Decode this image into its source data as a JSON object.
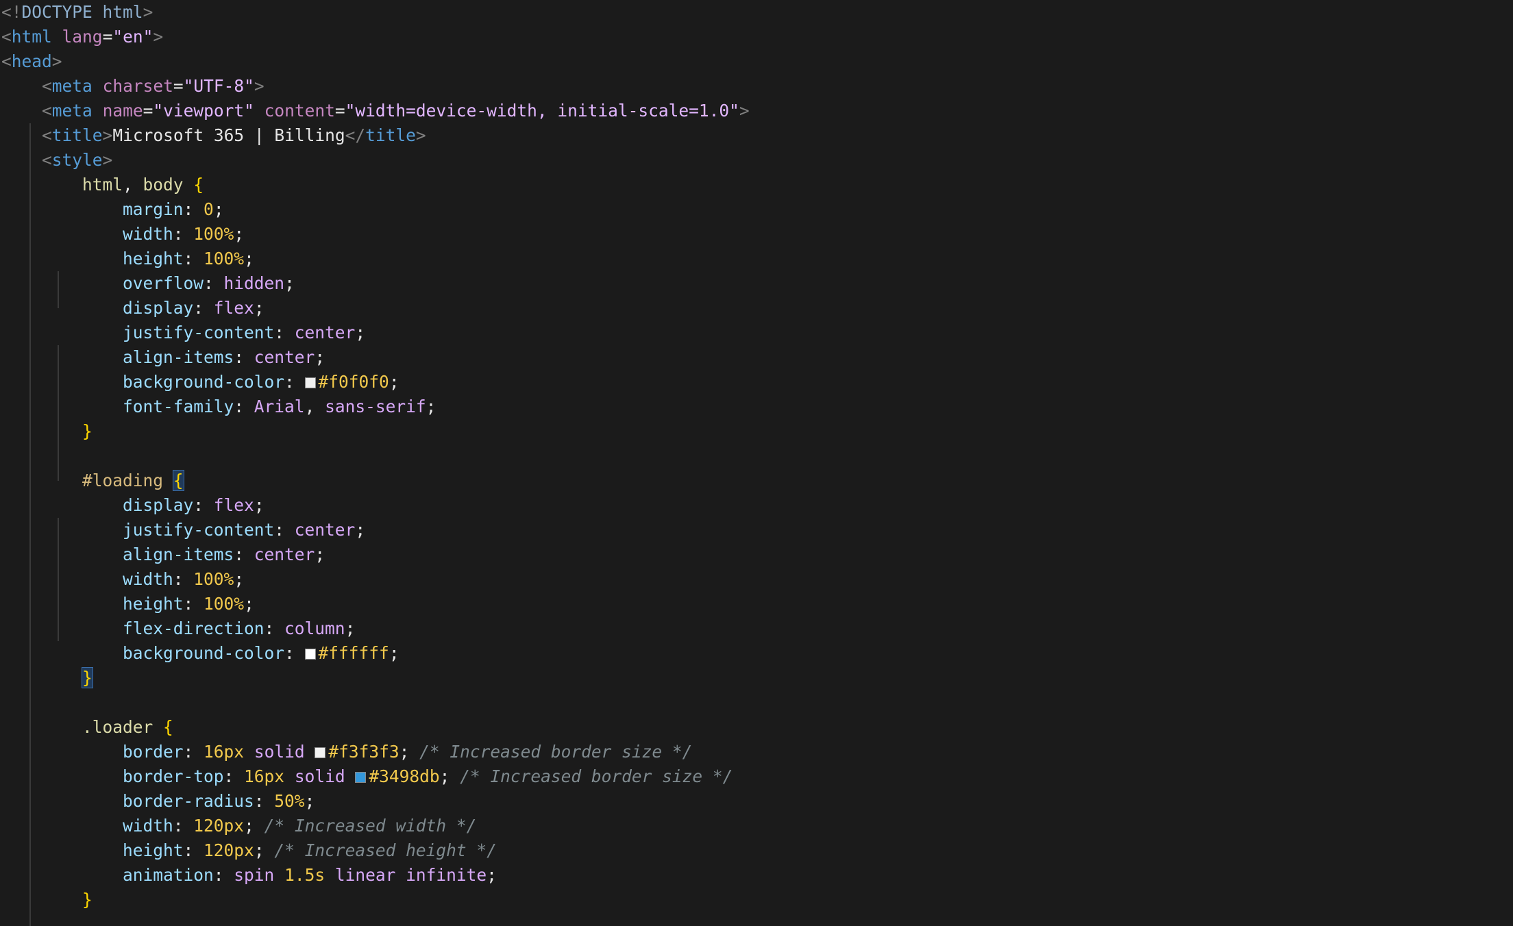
{
  "editor": {
    "lines": [
      [
        {
          "c": "t-punct",
          "t": "<!"
        },
        {
          "c": "t-doctype",
          "t": "DOCTYPE"
        },
        {
          "c": "t-text",
          "t": " "
        },
        {
          "c": "t-doctype",
          "t": "html"
        },
        {
          "c": "t-punct",
          "t": ">"
        }
      ],
      [
        {
          "c": "t-punct",
          "t": "<"
        },
        {
          "c": "t-tag",
          "t": "html"
        },
        {
          "c": "t-text",
          "t": " "
        },
        {
          "c": "t-attr",
          "t": "lang"
        },
        {
          "c": "t-text",
          "t": "="
        },
        {
          "c": "t-str2",
          "t": "\"en\""
        },
        {
          "c": "t-punct",
          "t": ">"
        }
      ],
      [
        {
          "c": "t-punct",
          "t": "<"
        },
        {
          "c": "t-tag",
          "t": "head"
        },
        {
          "c": "t-punct",
          "t": ">"
        }
      ],
      [
        {
          "c": "t-text",
          "t": "    "
        },
        {
          "c": "t-punct",
          "t": "<"
        },
        {
          "c": "t-tag",
          "t": "meta"
        },
        {
          "c": "t-text",
          "t": " "
        },
        {
          "c": "t-attr",
          "t": "charset"
        },
        {
          "c": "t-text",
          "t": "="
        },
        {
          "c": "t-str2",
          "t": "\"UTF-8\""
        },
        {
          "c": "t-punct",
          "t": ">"
        }
      ],
      [
        {
          "c": "t-text",
          "t": "    "
        },
        {
          "c": "t-punct",
          "t": "<"
        },
        {
          "c": "t-tag",
          "t": "meta"
        },
        {
          "c": "t-text",
          "t": " "
        },
        {
          "c": "t-attr",
          "t": "name"
        },
        {
          "c": "t-text",
          "t": "="
        },
        {
          "c": "t-str2",
          "t": "\"viewport\""
        },
        {
          "c": "t-text",
          "t": " "
        },
        {
          "c": "t-attr",
          "t": "content"
        },
        {
          "c": "t-text",
          "t": "="
        },
        {
          "c": "t-str2",
          "t": "\"width=device-width, initial-scale=1.0\""
        },
        {
          "c": "t-punct",
          "t": ">"
        }
      ],
      [
        {
          "c": "t-text",
          "t": "    "
        },
        {
          "c": "t-punct",
          "t": "<"
        },
        {
          "c": "t-tag",
          "t": "title"
        },
        {
          "c": "t-punct",
          "t": ">"
        },
        {
          "c": "t-text",
          "t": "Microsoft 365 | Billing"
        },
        {
          "c": "t-punct",
          "t": "</"
        },
        {
          "c": "t-tag",
          "t": "title"
        },
        {
          "c": "t-punct",
          "t": ">"
        }
      ],
      [
        {
          "c": "t-text",
          "t": "    "
        },
        {
          "c": "t-punct",
          "t": "<"
        },
        {
          "c": "t-tag",
          "t": "style"
        },
        {
          "c": "t-punct",
          "t": ">"
        }
      ],
      [
        {
          "c": "t-text",
          "t": "        "
        },
        {
          "c": "t-sel",
          "t": "html"
        },
        {
          "c": "t-text",
          "t": ", "
        },
        {
          "c": "t-sel",
          "t": "body"
        },
        {
          "c": "t-text",
          "t": " "
        },
        {
          "c": "t-brace",
          "t": "{"
        }
      ],
      [
        {
          "c": "t-text",
          "t": "            "
        },
        {
          "c": "t-prop",
          "t": "margin"
        },
        {
          "c": "t-text",
          "t": ": "
        },
        {
          "c": "t-num",
          "t": "0"
        },
        {
          "c": "t-text",
          "t": ";"
        }
      ],
      [
        {
          "c": "t-text",
          "t": "            "
        },
        {
          "c": "t-prop",
          "t": "width"
        },
        {
          "c": "t-text",
          "t": ": "
        },
        {
          "c": "t-num",
          "t": "100%"
        },
        {
          "c": "t-text",
          "t": ";"
        }
      ],
      [
        {
          "c": "t-text",
          "t": "            "
        },
        {
          "c": "t-prop",
          "t": "height"
        },
        {
          "c": "t-text",
          "t": ": "
        },
        {
          "c": "t-num",
          "t": "100%"
        },
        {
          "c": "t-text",
          "t": ";"
        }
      ],
      [
        {
          "c": "t-text",
          "t": "            "
        },
        {
          "c": "t-prop",
          "t": "overflow"
        },
        {
          "c": "t-text",
          "t": ": "
        },
        {
          "c": "t-val",
          "t": "hidden"
        },
        {
          "c": "t-text",
          "t": ";"
        }
      ],
      [
        {
          "c": "t-text",
          "t": "            "
        },
        {
          "c": "t-prop",
          "t": "display"
        },
        {
          "c": "t-text",
          "t": ": "
        },
        {
          "c": "t-val",
          "t": "flex"
        },
        {
          "c": "t-text",
          "t": ";"
        }
      ],
      [
        {
          "c": "t-text",
          "t": "            "
        },
        {
          "c": "t-prop",
          "t": "justify-content"
        },
        {
          "c": "t-text",
          "t": ": "
        },
        {
          "c": "t-val",
          "t": "center"
        },
        {
          "c": "t-text",
          "t": ";"
        }
      ],
      [
        {
          "c": "t-text",
          "t": "            "
        },
        {
          "c": "t-prop",
          "t": "align-items"
        },
        {
          "c": "t-text",
          "t": ": "
        },
        {
          "c": "t-val",
          "t": "center"
        },
        {
          "c": "t-text",
          "t": ";"
        }
      ],
      [
        {
          "c": "t-text",
          "t": "            "
        },
        {
          "c": "t-prop",
          "t": "background-color"
        },
        {
          "c": "t-text",
          "t": ": "
        },
        {
          "c": "swatch",
          "color": "#f0f0f0"
        },
        {
          "c": "t-num",
          "t": "#f0f0f0"
        },
        {
          "c": "t-text",
          "t": ";"
        }
      ],
      [
        {
          "c": "t-text",
          "t": "            "
        },
        {
          "c": "t-prop",
          "t": "font-family"
        },
        {
          "c": "t-text",
          "t": ": "
        },
        {
          "c": "t-val",
          "t": "Arial"
        },
        {
          "c": "t-text",
          "t": ", "
        },
        {
          "c": "t-val",
          "t": "sans-serif"
        },
        {
          "c": "t-text",
          "t": ";"
        }
      ],
      [
        {
          "c": "t-text",
          "t": "        "
        },
        {
          "c": "t-brace",
          "t": "}"
        }
      ],
      [],
      [
        {
          "c": "t-text",
          "t": "        "
        },
        {
          "c": "t-selid",
          "t": "#loading"
        },
        {
          "c": "t-text",
          "t": " "
        },
        {
          "c": "t-brace bracket-hl",
          "t": "{"
        }
      ],
      [
        {
          "c": "t-text",
          "t": "            "
        },
        {
          "c": "t-prop",
          "t": "display"
        },
        {
          "c": "t-text",
          "t": ": "
        },
        {
          "c": "t-val",
          "t": "flex"
        },
        {
          "c": "t-text",
          "t": ";"
        }
      ],
      [
        {
          "c": "t-text",
          "t": "            "
        },
        {
          "c": "t-prop",
          "t": "justify-content"
        },
        {
          "c": "t-text",
          "t": ": "
        },
        {
          "c": "t-val",
          "t": "center"
        },
        {
          "c": "t-text",
          "t": ";"
        }
      ],
      [
        {
          "c": "t-text",
          "t": "            "
        },
        {
          "c": "t-prop",
          "t": "align-items"
        },
        {
          "c": "t-text",
          "t": ": "
        },
        {
          "c": "t-val",
          "t": "center"
        },
        {
          "c": "t-text",
          "t": ";"
        }
      ],
      [
        {
          "c": "t-text",
          "t": "            "
        },
        {
          "c": "t-prop",
          "t": "width"
        },
        {
          "c": "t-text",
          "t": ": "
        },
        {
          "c": "t-num",
          "t": "100%"
        },
        {
          "c": "t-text",
          "t": ";"
        }
      ],
      [
        {
          "c": "t-text",
          "t": "            "
        },
        {
          "c": "t-prop",
          "t": "height"
        },
        {
          "c": "t-text",
          "t": ": "
        },
        {
          "c": "t-num",
          "t": "100%"
        },
        {
          "c": "t-text",
          "t": ";"
        }
      ],
      [
        {
          "c": "t-text",
          "t": "            "
        },
        {
          "c": "t-prop",
          "t": "flex-direction"
        },
        {
          "c": "t-text",
          "t": ": "
        },
        {
          "c": "t-val",
          "t": "column"
        },
        {
          "c": "t-text",
          "t": ";"
        }
      ],
      [
        {
          "c": "t-text",
          "t": "            "
        },
        {
          "c": "t-prop",
          "t": "background-color"
        },
        {
          "c": "t-text",
          "t": ": "
        },
        {
          "c": "swatch",
          "color": "#ffffff"
        },
        {
          "c": "t-num",
          "t": "#ffffff"
        },
        {
          "c": "t-text",
          "t": ";"
        }
      ],
      [
        {
          "c": "t-text",
          "t": "        "
        },
        {
          "c": "t-brace bracket-hl",
          "t": "}"
        }
      ],
      [],
      [
        {
          "c": "t-text",
          "t": "        "
        },
        {
          "c": "t-sel",
          "t": ".loader"
        },
        {
          "c": "t-text",
          "t": " "
        },
        {
          "c": "t-brace",
          "t": "{"
        }
      ],
      [
        {
          "c": "t-text",
          "t": "            "
        },
        {
          "c": "t-prop",
          "t": "border"
        },
        {
          "c": "t-text",
          "t": ": "
        },
        {
          "c": "t-num",
          "t": "16px"
        },
        {
          "c": "t-text",
          "t": " "
        },
        {
          "c": "t-val",
          "t": "solid"
        },
        {
          "c": "t-text",
          "t": " "
        },
        {
          "c": "swatch",
          "color": "#f3f3f3"
        },
        {
          "c": "t-num",
          "t": "#f3f3f3"
        },
        {
          "c": "t-text",
          "t": "; "
        },
        {
          "c": "t-comment",
          "t": "/* Increased border size */"
        }
      ],
      [
        {
          "c": "t-text",
          "t": "            "
        },
        {
          "c": "t-prop",
          "t": "border-top"
        },
        {
          "c": "t-text",
          "t": ": "
        },
        {
          "c": "t-num",
          "t": "16px"
        },
        {
          "c": "t-text",
          "t": " "
        },
        {
          "c": "t-val",
          "t": "solid"
        },
        {
          "c": "t-text",
          "t": " "
        },
        {
          "c": "swatch",
          "color": "#3498db"
        },
        {
          "c": "t-num",
          "t": "#3498db"
        },
        {
          "c": "t-text",
          "t": "; "
        },
        {
          "c": "t-comment",
          "t": "/* Increased border size */"
        }
      ],
      [
        {
          "c": "t-text",
          "t": "            "
        },
        {
          "c": "t-prop",
          "t": "border-radius"
        },
        {
          "c": "t-text",
          "t": ": "
        },
        {
          "c": "t-num",
          "t": "50%"
        },
        {
          "c": "t-text",
          "t": ";"
        }
      ],
      [
        {
          "c": "t-text",
          "t": "            "
        },
        {
          "c": "t-prop",
          "t": "width"
        },
        {
          "c": "t-text",
          "t": ": "
        },
        {
          "c": "t-num",
          "t": "120px"
        },
        {
          "c": "t-text",
          "t": "; "
        },
        {
          "c": "t-comment",
          "t": "/* Increased width */"
        }
      ],
      [
        {
          "c": "t-text",
          "t": "            "
        },
        {
          "c": "t-prop",
          "t": "height"
        },
        {
          "c": "t-text",
          "t": ": "
        },
        {
          "c": "t-num",
          "t": "120px"
        },
        {
          "c": "t-text",
          "t": "; "
        },
        {
          "c": "t-comment",
          "t": "/* Increased height */"
        }
      ],
      [
        {
          "c": "t-text",
          "t": "            "
        },
        {
          "c": "t-prop",
          "t": "animation"
        },
        {
          "c": "t-text",
          "t": ": "
        },
        {
          "c": "t-val",
          "t": "spin"
        },
        {
          "c": "t-text",
          "t": " "
        },
        {
          "c": "t-num",
          "t": "1.5s"
        },
        {
          "c": "t-text",
          "t": " "
        },
        {
          "c": "t-val",
          "t": "linear"
        },
        {
          "c": "t-text",
          "t": " "
        },
        {
          "c": "t-val",
          "t": "infinite"
        },
        {
          "c": "t-text",
          "t": ";"
        }
      ],
      [
        {
          "c": "t-text",
          "t": "        "
        },
        {
          "c": "t-brace",
          "t": "}"
        }
      ]
    ]
  },
  "colors": {
    "background": "#1b1b1b",
    "indent_guide": "#3a3a3a"
  }
}
